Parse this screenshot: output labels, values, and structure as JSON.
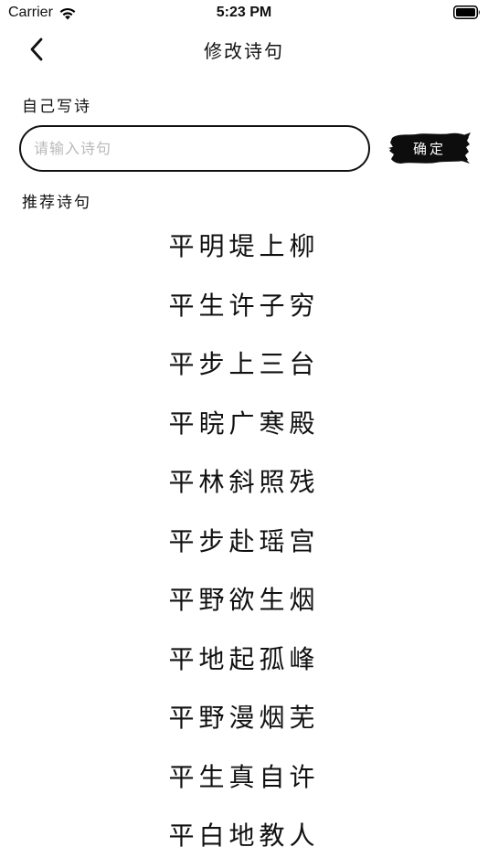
{
  "status_bar": {
    "carrier": "Carrier",
    "time": "5:23 PM",
    "wifi_icon": "wifi-icon",
    "battery_icon": "battery-icon"
  },
  "nav": {
    "back_icon": "chevron-left-icon",
    "title": "修改诗句"
  },
  "custom": {
    "label": "自己写诗",
    "input_value": "",
    "input_placeholder": "请输入诗句",
    "confirm_label": "确定"
  },
  "recommend": {
    "label": "推荐诗句",
    "items": [
      "平明堤上柳",
      "平生许子穷",
      "平步上三台",
      "平睆广寒殿",
      "平林斜照残",
      "平步赴瑶宫",
      "平野欲生烟",
      "平地起孤峰",
      "平野漫烟芜",
      "平生真自许",
      "平白地教人"
    ]
  },
  "colors": {
    "text": "#111111",
    "placeholder": "#b9b9b9",
    "ink": "#0d0d0d",
    "background": "#ffffff"
  }
}
